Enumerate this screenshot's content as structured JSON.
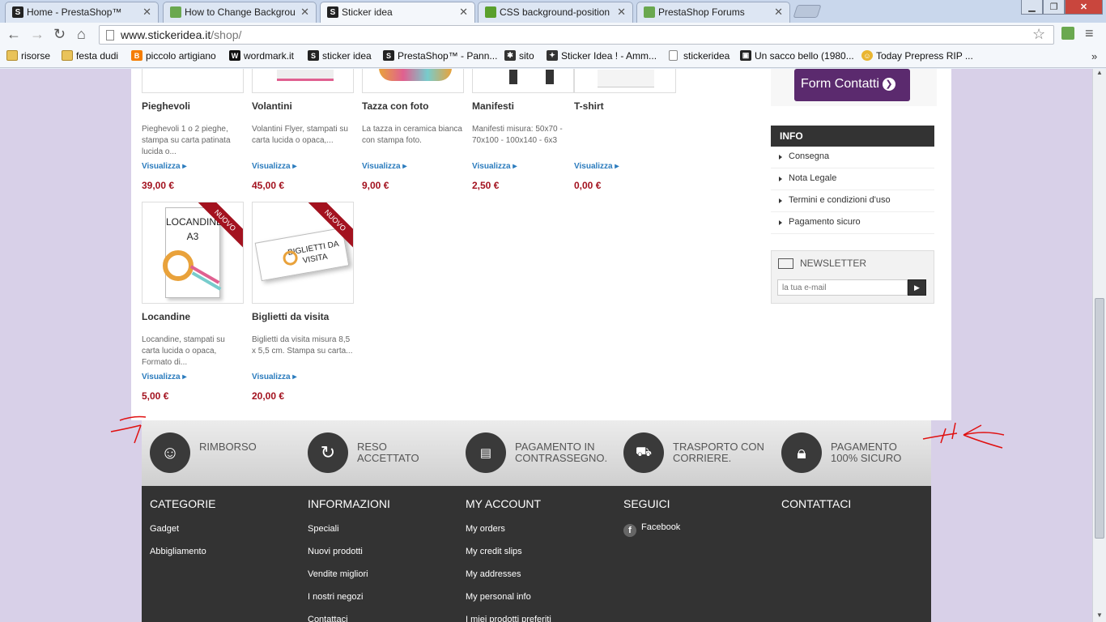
{
  "browser": {
    "tabs": [
      {
        "title": "Home - PrestaShop™",
        "icon": "prestashop-icon",
        "color": "#222"
      },
      {
        "title": "How to Change Backgrou",
        "icon": "prestashop-forum-icon",
        "color": "#6aa84f"
      },
      {
        "title": "Sticker idea",
        "icon": "prestashop-icon",
        "color": "#222"
      },
      {
        "title": "CSS background-position",
        "icon": "stack-icon",
        "color": "#5aa02c"
      },
      {
        "title": "PrestaShop Forums",
        "icon": "prestashop-forum-icon",
        "color": "#6aa84f"
      }
    ],
    "url_host": "www.stickeridea.it",
    "url_path": "/shop/",
    "bookmarks": [
      {
        "label": "risorse",
        "icon": "folder-icon"
      },
      {
        "label": "festa dudi",
        "icon": "folder-icon"
      },
      {
        "label": "piccolo artigiano",
        "icon": "blogger-icon",
        "color": "#f57d00"
      },
      {
        "label": "wordmark.it",
        "icon": "wordmark-icon",
        "color": "#111"
      },
      {
        "label": "sticker idea",
        "icon": "prestashop-icon",
        "color": "#222"
      },
      {
        "label": "PrestaShop™ - Pann...",
        "icon": "prestashop-icon",
        "color": "#222"
      },
      {
        "label": "sito",
        "icon": "joomla-icon",
        "color": "#333"
      },
      {
        "label": "Sticker Idea ! - Amm...",
        "icon": "sticker-icon",
        "color": "#333"
      },
      {
        "label": "stickeridea",
        "icon": "page-icon",
        "color": "#fff"
      },
      {
        "label": "Un sacco bello (1980...",
        "icon": "film-icon",
        "color": "#222"
      },
      {
        "label": "Today Prepress RIP ...",
        "icon": "smiley-icon",
        "color": "#e9b531"
      }
    ]
  },
  "products": [
    {
      "name": "Pieghevoli",
      "desc": "Pieghevoli 1 o 2 pieghe, stampa su carta patinata lucida o...",
      "link": "Visualizza",
      "price": "39,00 €"
    },
    {
      "name": "Volantini",
      "desc": "Volantini Flyer, stampati su carta lucida o opaca,...",
      "link": "Visualizza",
      "price": "45,00 €"
    },
    {
      "name": "Tazza con foto",
      "desc": "La tazza in ceramica bianca con stampa foto.",
      "link": "Visualizza",
      "price": "9,00 €"
    },
    {
      "name": "Manifesti",
      "desc": "Manifesti misura: 50x70 - 70x100 - 100x140 - 6x3",
      "link": "Visualizza",
      "price": "2,50 €"
    },
    {
      "name": "T-shirt",
      "desc": "",
      "link": "Visualizza",
      "price": "0,00 €"
    },
    {
      "name": "Locandine",
      "desc": "Locandine, stampati su carta lucida o opaca, Formato di...",
      "link": "Visualizza",
      "price": "5,00 €",
      "badge": "NUOVO",
      "img_text": "LOCANDINE A3"
    },
    {
      "name": "Biglietti da visita",
      "desc": "Biglietti da visita misura 8,5 x 5,5 cm.  Stampa su carta...",
      "link": "Visualizza",
      "price": "20,00 €",
      "badge": "NUOVO",
      "img_text": "BIGLIETTI DA VISITA"
    }
  ],
  "sidebar": {
    "form_button": "Form Contatti",
    "info_title": "INFO",
    "info_items": [
      "Consegna",
      "Nota Legale",
      "Termini e condizioni d'uso",
      "Pagamento sicuro"
    ],
    "newsletter_title": "NEWSLETTER",
    "newsletter_placeholder": "la tua e-mail"
  },
  "reassurance": [
    {
      "text": "RIMBORSO",
      "icon": "smiley-icon"
    },
    {
      "text": "RESO\nACCETTATO",
      "icon": "refresh-icon"
    },
    {
      "text": "PAGAMENTO IN\nCONTRASSEGNO.",
      "icon": "cash-icon"
    },
    {
      "text": "TRASPORTO CON\nCORRIERE.",
      "icon": "truck-icon"
    },
    {
      "text": "PAGAMENTO\n100% SICURO",
      "icon": "lock-icon"
    }
  ],
  "footer": {
    "columns": [
      {
        "title": "CATEGORIE",
        "links": [
          "Gadget",
          "Abbigliamento"
        ]
      },
      {
        "title": "INFORMAZIONI",
        "links": [
          "Speciali",
          "Nuovi prodotti",
          "Vendite migliori",
          "I nostri negozi",
          "Contattaci"
        ]
      },
      {
        "title": "MY ACCOUNT",
        "links": [
          "My orders",
          "My credit slips",
          "My addresses",
          "My personal info",
          "I miei prodotti preferiti"
        ]
      },
      {
        "title": "SEGUICI",
        "links": [
          "Facebook"
        ]
      },
      {
        "title": "CONTATTACI",
        "links": []
      }
    ]
  }
}
